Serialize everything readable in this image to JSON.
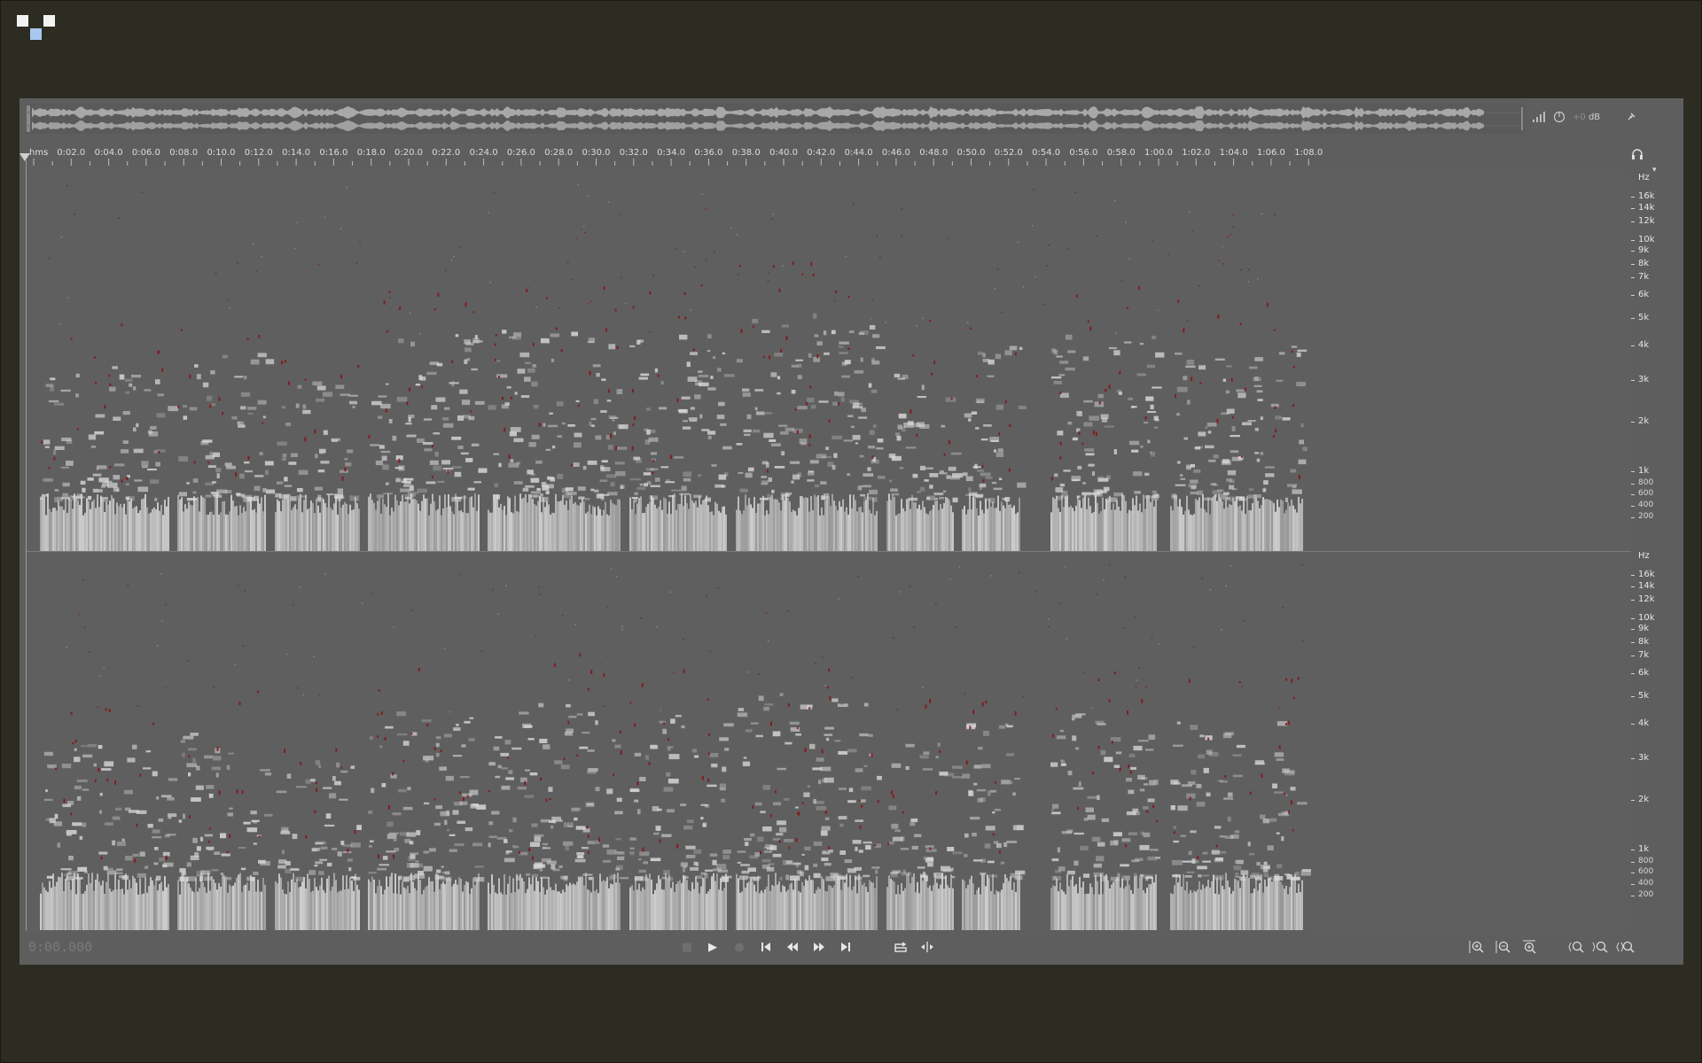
{
  "window": {
    "logo_icon": "app-logo-icon"
  },
  "overview": {
    "db_value": "+0",
    "db_unit": "dB",
    "icons": [
      "level-meter-icon",
      "pan-knob-icon",
      "pin-icon"
    ]
  },
  "ruler": {
    "unit": "hms",
    "labels": [
      "0:02.0",
      "0:04.0",
      "0:06.0",
      "0:08.0",
      "0:10.0",
      "0:12.0",
      "0:14.0",
      "0:16.0",
      "0:18.0",
      "0:20.0",
      "0:22.0",
      "0:24.0",
      "0:26.0",
      "0:28.0",
      "0:30.0",
      "0:32.0",
      "0:34.0",
      "0:36.0",
      "0:38.0",
      "0:40.0",
      "0:42.0",
      "0:44.0",
      "0:46.0",
      "0:48.0",
      "0:50.0",
      "0:52.0",
      "0:54.0",
      "0:56.0",
      "0:58.0",
      "1:00.0",
      "1:02.0",
      "1:04.0",
      "1:06.0",
      "1:08.0"
    ]
  },
  "spectrogram": {
    "freq_unit": "Hz",
    "freq_labels": [
      "16k",
      "14k",
      "12k",
      "10k",
      "9k",
      "8k",
      "7k",
      "6k",
      "5k",
      "4k",
      "3k",
      "2k",
      "1k",
      "800",
      "600",
      "400",
      "200"
    ],
    "colors": {
      "background": "#5f5f5f",
      "energy": "#d9d9d9",
      "peak": "#8a0f14"
    }
  },
  "transport": {
    "timecode": "0:00.000",
    "buttons": [
      "stop-icon",
      "play-icon",
      "record-icon",
      "skip-to-start-icon",
      "rewind-icon",
      "fast-forward-icon",
      "skip-to-end-icon",
      "loop-icon",
      "scrub-icon"
    ]
  },
  "zoom": {
    "buttons": [
      "zoom-in-time-icon",
      "zoom-out-time-icon",
      "zoom-full-icon",
      "zoom-in-frequency-icon",
      "zoom-out-frequency-icon",
      "zoom-fit-icon"
    ]
  }
}
